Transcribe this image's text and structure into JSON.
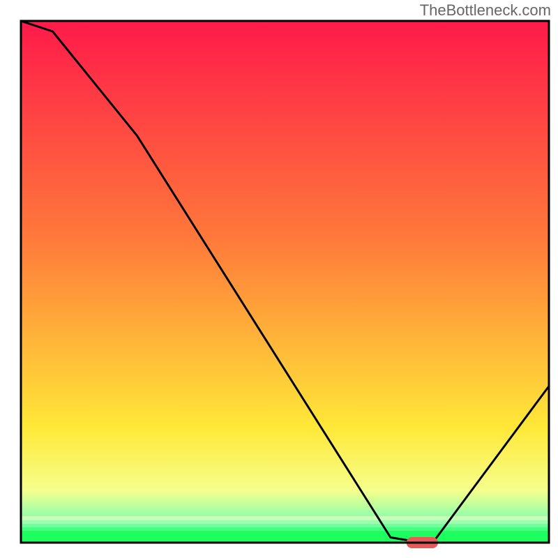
{
  "watermark": "TheBottleneck.com",
  "chart_data": {
    "type": "line",
    "title": "",
    "xlabel": "",
    "ylabel": "",
    "xlim": [
      0,
      100
    ],
    "ylim": [
      0,
      100
    ],
    "x": [
      0,
      6,
      22,
      70,
      76,
      78,
      100
    ],
    "y": [
      100,
      98,
      78,
      1,
      0,
      0,
      30
    ],
    "minimum_marker": {
      "x_start": 73,
      "x_end": 79,
      "y": 0
    },
    "background_gradient": {
      "top": "#ff1a4a",
      "mid_upper": "#ff7a3a",
      "mid_lower": "#ffe838",
      "lower": "#f6ff8c",
      "bottom": "#1cff5e"
    },
    "annotations": []
  }
}
